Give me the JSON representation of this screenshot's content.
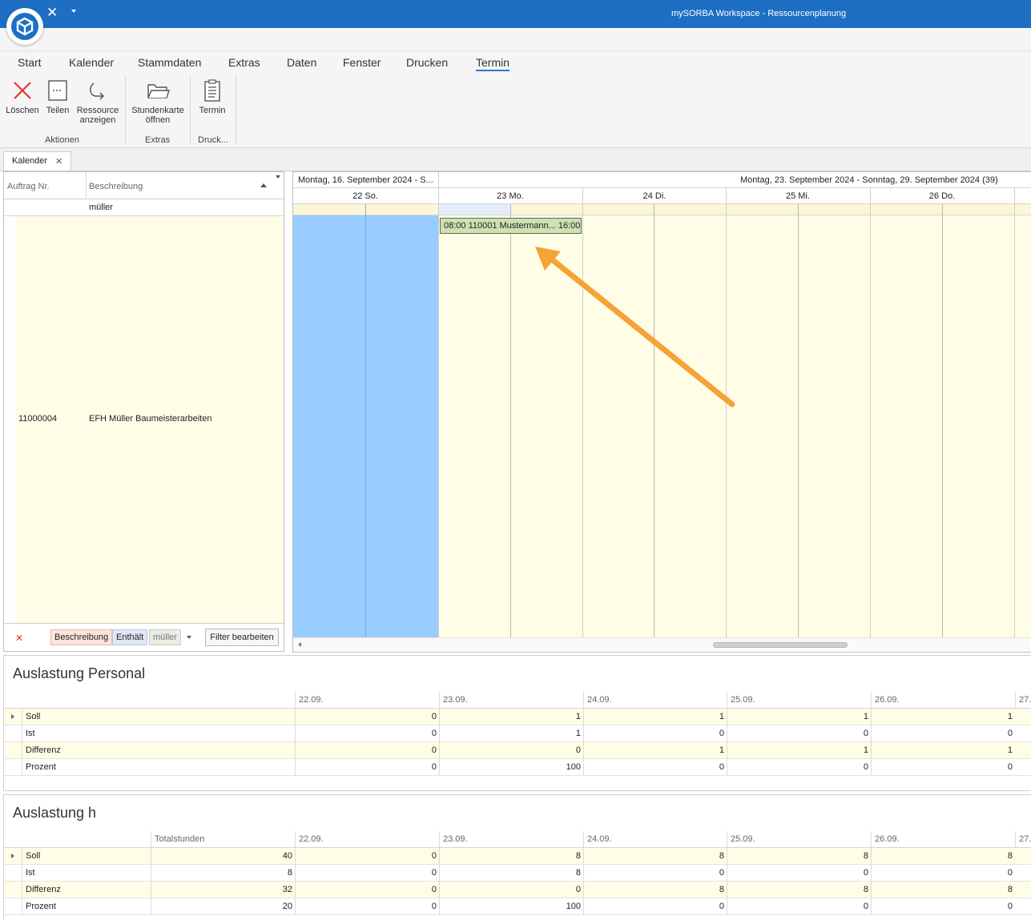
{
  "window": {
    "title": "mySORBA Workspace - Ressourcenplanung"
  },
  "ribbon": {
    "tabs": [
      "Start",
      "Kalender",
      "Stammdaten",
      "Extras",
      "Daten",
      "Fenster",
      "Drucken",
      "Termin"
    ],
    "active_tab": "Termin",
    "buttons": {
      "delete": "Löschen",
      "split": "Teilen",
      "show_resource_1": "Ressource",
      "show_resource_2": "anzeigen",
      "timecard_1": "Stundenkarte",
      "timecard_2": "öffnen",
      "appointment": "Termin"
    },
    "groups": {
      "actions": "Aktionen",
      "extras": "Extras",
      "print": "Druck..."
    }
  },
  "doc_tab": {
    "label": "Kalender"
  },
  "left_grid": {
    "col_order": "Auftrag Nr.",
    "col_desc": "Beschreibung",
    "filter_value": "müller",
    "row": {
      "order_no": "11000004",
      "description": "EFH Müller Baumeisterarbeiten"
    },
    "filter_bar": {
      "field": "Beschreibung",
      "operator": "Enthält",
      "value": "müller",
      "edit_button": "Filter bearbeiten"
    }
  },
  "scheduler": {
    "week_prev": "Montag, 16. September 2024 - S...",
    "week_current": "Montag, 23. September 2024 - Sonntag, 29. September 2024 (39)",
    "days": [
      "22 So.",
      "23 Mo.",
      "24 Di.",
      "25 Mi.",
      "26 Do."
    ],
    "appointment": "08:00 110001 Mustermann... 16:00"
  },
  "personal_panel": {
    "title": "Auslastung Personal",
    "columns": [
      "22.09.",
      "23.09.",
      "24.09.",
      "25.09.",
      "26.09.",
      "27."
    ],
    "rows": [
      {
        "label": "Soll",
        "values": [
          "0",
          "1",
          "1",
          "1",
          "1"
        ]
      },
      {
        "label": "Ist",
        "values": [
          "0",
          "1",
          "0",
          "0",
          "0"
        ]
      },
      {
        "label": "Differenz",
        "values": [
          "0",
          "0",
          "1",
          "1",
          "1"
        ]
      },
      {
        "label": "Prozent",
        "values": [
          "0",
          "100",
          "0",
          "0",
          "0"
        ]
      }
    ]
  },
  "hours_panel": {
    "title": "Auslastung h",
    "total_header": "Totalstunden",
    "columns": [
      "22.09.",
      "23.09.",
      "24.09.",
      "25.09.",
      "26.09.",
      "27."
    ],
    "rows": [
      {
        "label": "Soll",
        "total": "40",
        "values": [
          "0",
          "8",
          "8",
          "8",
          "8"
        ]
      },
      {
        "label": "Ist",
        "total": "8",
        "values": [
          "0",
          "8",
          "0",
          "0",
          "0"
        ]
      },
      {
        "label": "Differenz",
        "total": "32",
        "values": [
          "0",
          "0",
          "8",
          "8",
          "8"
        ]
      },
      {
        "label": "Prozent",
        "total": "20",
        "values": [
          "0",
          "100",
          "0",
          "0",
          "0"
        ]
      }
    ]
  }
}
